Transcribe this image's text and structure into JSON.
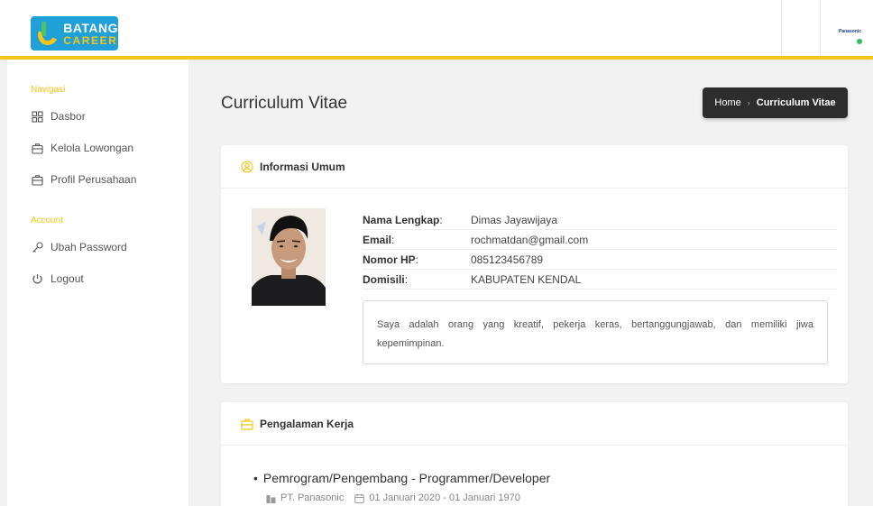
{
  "header": {
    "logo_line1": "BATANG",
    "logo_line2": "CAREER",
    "company_mini": "Panasonic"
  },
  "sidebar": {
    "sections": [
      {
        "heading": "Navigasi",
        "items": [
          {
            "label": "Dasbor",
            "icon": "dashboard-icon"
          },
          {
            "label": "Kelola Lowongan",
            "icon": "briefcase-icon"
          },
          {
            "label": "Profil Perusahaan",
            "icon": "briefcase-icon"
          }
        ]
      },
      {
        "heading": "Account",
        "items": [
          {
            "label": "Ubah Password",
            "icon": "key-icon"
          },
          {
            "label": "Logout",
            "icon": "power-icon"
          }
        ]
      }
    ]
  },
  "page": {
    "title": "Curriculum Vitae",
    "breadcrumb": {
      "home": "Home",
      "current": "Curriculum Vitae"
    }
  },
  "info_card": {
    "title": "Informasi Umum",
    "rows": [
      {
        "label": "Nama Lengkap",
        "value": "Dimas Jayawijaya"
      },
      {
        "label": "Email",
        "value": "rochmatdan@gmail.com"
      },
      {
        "label": "Nomor HP",
        "value": "085123456789"
      },
      {
        "label": "Domisili",
        "value": "KABUPATEN KENDAL"
      }
    ],
    "about": "Saya adalah orang yang kreatif, pekerja keras, bertanggungjawab, dan memiliki jiwa kepemimpinan."
  },
  "experience_card": {
    "title": "Pengalaman Kerja",
    "jobs": [
      {
        "position": "Pemrogram/Pengembang - Programmer/Developer",
        "company": "PT. Panasonic",
        "period": "01 Januari 2020 - 01 Januari 1970"
      }
    ]
  },
  "colors": {
    "accent": "#f5c518",
    "logo_bg": "#1fa0d8",
    "breadcrumb_bg": "#2d2d2d",
    "online": "#2bbf5c"
  }
}
